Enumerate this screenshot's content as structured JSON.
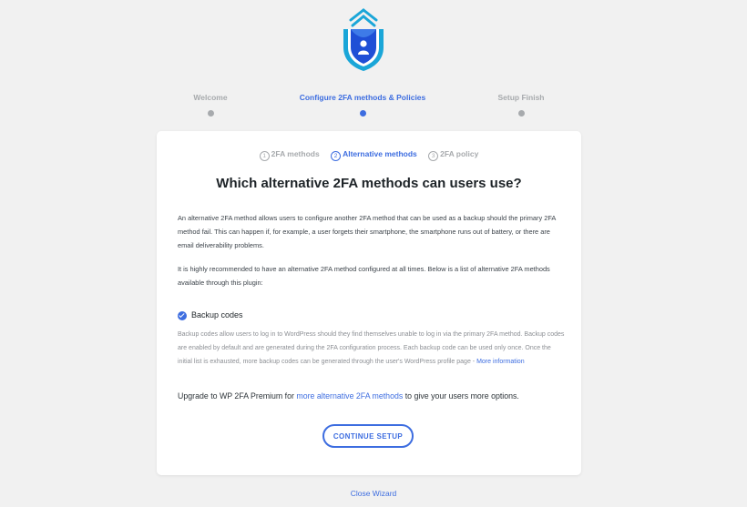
{
  "wizard": {
    "steps": [
      {
        "label": "Welcome",
        "state": "inactive"
      },
      {
        "label": "Configure 2FA methods & Policies",
        "state": "active"
      },
      {
        "label": "Setup Finish",
        "state": "inactive"
      }
    ],
    "substeps": [
      {
        "num": "1",
        "label": "2FA methods",
        "state": "inactive"
      },
      {
        "num": "2",
        "label": "Alternative methods",
        "state": "active"
      },
      {
        "num": "3",
        "label": "2FA policy",
        "state": "inactive"
      }
    ],
    "close_label": "Close Wizard"
  },
  "card": {
    "heading": "Which alternative 2FA methods can users use?",
    "intro": "An alternative 2FA method allows users to configure another 2FA method that can be used as a backup should the primary 2FA method fail. This can happen if, for example, a user forgets their smartphone, the smartphone runs out of battery, or there are email deliverability problems.",
    "recommend": "It is highly recommended to have an alternative 2FA method configured at all times. Below is a list of alternative 2FA methods available through this plugin:",
    "method": {
      "name": "Backup codes",
      "checked": true,
      "description": "Backup codes allow users to log in to WordPress should they find themselves unable to log in via the primary 2FA method. Backup codes are enabled by default and are generated during the 2FA configuration process. Each backup code can be used only once. Once the initial list is exhausted, more backup codes can be generated through the user's WordPress profile page - ",
      "more_link": "More information"
    },
    "upgrade": {
      "prefix": "Upgrade to WP 2FA Premium for ",
      "link": "more alternative 2FA methods",
      "suffix": " to give your users more options."
    },
    "continue_label": "CONTINUE SETUP"
  },
  "colors": {
    "accent": "#3d6de0",
    "inactive": "#a7aaad",
    "background": "#f1f1f1"
  }
}
